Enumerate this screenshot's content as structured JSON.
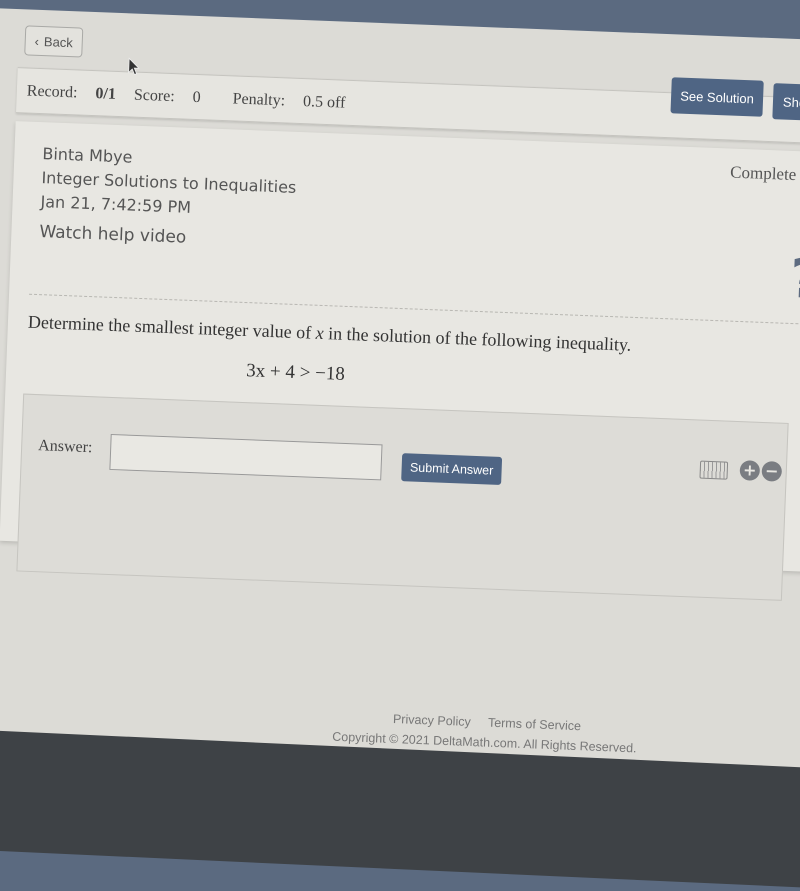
{
  "nav": {
    "back_label": "Back"
  },
  "record_bar": {
    "record_label": "Record:",
    "record_value": "0/1",
    "score_label": "Score:",
    "score_value": "0",
    "penalty_label": "Penalty:",
    "penalty_value": "0.5 off",
    "see_solution_label": "See Solution",
    "show_label": "Show"
  },
  "problem_info": {
    "student_name": "Binta Mbye",
    "topic": "Integer Solutions to Inequalities",
    "timestamp": "Jan 21, 7:42:59 PM",
    "help_video_label": "Watch help video",
    "status": "Complete",
    "help_icon": "question-mark-icon"
  },
  "question": {
    "prompt_before": "Determine the smallest integer value of ",
    "prompt_var": "x",
    "prompt_after": " in the solution of the following inequality.",
    "equation": "3x + 4 > −18"
  },
  "answer": {
    "label": "Answer:",
    "value": "",
    "placeholder": "",
    "submit_label": "Submit Answer",
    "keyboard_icon": "keyboard-icon",
    "zoom_in_icon": "+",
    "zoom_out_icon": "−"
  },
  "footer": {
    "privacy_label": "Privacy Policy",
    "terms_label": "Terms of Service",
    "copyright": "Copyright © 2021 DeltaMath.com. All Rights Reserved."
  },
  "colors": {
    "accent": "#4f6584",
    "page_bg": "#dcdbd6",
    "text": "#444444"
  }
}
